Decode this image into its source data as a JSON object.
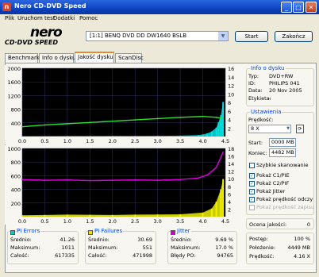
{
  "window": {
    "title": "Nero CD-DVD Speed"
  },
  "menu": [
    "Plik",
    "Uruchom test",
    "Dodatki",
    "Pomoc"
  ],
  "logo": {
    "nero": "nero",
    "sub": "CD·DVD SPEED"
  },
  "drive": {
    "selected": "[1:1]  BENQ DVD DD DW1640 BSLB"
  },
  "buttons": {
    "start": "Start",
    "close": "Zakończ"
  },
  "tabs": [
    "Benchmark",
    "Info o dysku",
    "Jakość dysku",
    "ScanDisc"
  ],
  "disc_info": {
    "title": "Info o dysku",
    "rows": [
      {
        "label": "Typ:",
        "value": "DVD+RW"
      },
      {
        "label": "ID:",
        "value": "PHILIPS 041"
      },
      {
        "label": "Data:",
        "value": "20 Nov 2005"
      },
      {
        "label": "Etykieta:",
        "value": "-"
      }
    ]
  },
  "settings": {
    "title": "Ustawienia",
    "speed_label": "Prędkość:",
    "speed_value": "8 X",
    "start_label": "Start:",
    "start_value": "0000 MB",
    "end_label": "Koniec:",
    "end_value": "4482 MB",
    "checkboxes": [
      {
        "label": "Szybkie skanowanie",
        "checked": false
      },
      {
        "label": "Pokaż C1/PIE",
        "checked": true
      },
      {
        "label": "Pokaż C2/PIF",
        "checked": true
      },
      {
        "label": "Pokaż Jitter",
        "checked": true
      },
      {
        "label": "Pokaż prędkość odczy",
        "checked": true
      },
      {
        "label": "Pokaż prędkość zapisu",
        "checked": false
      }
    ]
  },
  "quality": {
    "label": "Ocena jakości:",
    "value": "0"
  },
  "progress": [
    {
      "label": "Postęp:",
      "value": "100 %"
    },
    {
      "label": "Położenie:",
      "value": "4449 MB"
    },
    {
      "label": "Prędkość:",
      "value": "4.16 X"
    }
  ],
  "stats": {
    "pie": {
      "title": "PI Errors",
      "color": "#00C8C8",
      "rows": [
        {
          "label": "Średnio:",
          "value": "41.26"
        },
        {
          "label": "Maksimum:",
          "value": "1011"
        },
        {
          "label": "Całość:",
          "value": "617335"
        }
      ]
    },
    "pif": {
      "title": "PI Failures",
      "color": "#F0E000",
      "rows": [
        {
          "label": "Średnio:",
          "value": "30.69"
        },
        {
          "label": "Maksimum:",
          "value": "551"
        },
        {
          "label": "Całość:",
          "value": "471998"
        }
      ]
    },
    "jitter": {
      "title": "Jitter",
      "color": "#D000D0",
      "rows": [
        {
          "label": "Średnio:",
          "value": "9.69 %"
        },
        {
          "label": "Maksimum:",
          "value": "17.0 %"
        },
        {
          "label": "Błędy PO:",
          "value": "94765"
        }
      ]
    }
  },
  "chart_data": [
    {
      "type": "area",
      "name": "PI Errors",
      "xlim": [
        0,
        4.5
      ],
      "ylim": [
        0,
        2000
      ],
      "y2lim": [
        0,
        16
      ],
      "x_ticks": [
        "0.0",
        "0.5",
        "1.0",
        "1.5",
        "2.0",
        "2.5",
        "3.0",
        "3.5",
        "4.0",
        "4.5"
      ],
      "y_ticks": [
        "2000",
        "1600",
        "1200",
        "800",
        "400"
      ],
      "y2_ticks": [
        "16",
        "14",
        "12",
        "10",
        "8",
        "6",
        "4",
        "2"
      ],
      "series": [
        {
          "color": "#00E0E0",
          "x": [
            0,
            0.5,
            1.0,
            1.5,
            2.0,
            2.5,
            3.0,
            3.5,
            3.9,
            4.0,
            4.1,
            4.2,
            4.3,
            4.35,
            4.4,
            4.45
          ],
          "values": [
            10,
            12,
            15,
            14,
            16,
            18,
            20,
            25,
            40,
            60,
            90,
            150,
            260,
            420,
            620,
            1011
          ]
        },
        {
          "color": "#30E030",
          "x": [
            0,
            0.5,
            1.0,
            1.5,
            2.0,
            2.5,
            3.0,
            3.5,
            4.0,
            4.3,
            4.45
          ],
          "values": [
            2.3,
            2.7,
            3.0,
            3.3,
            3.6,
            3.9,
            4.2,
            4.5,
            4.7,
            4.5,
            4.2
          ]
        }
      ]
    },
    {
      "type": "area",
      "name": "PI Failures / Jitter",
      "xlim": [
        0,
        4.5
      ],
      "ylim": [
        0,
        1000
      ],
      "y2lim": [
        0,
        18
      ],
      "x_ticks": [
        "0.0",
        "0.5",
        "1.0",
        "1.5",
        "2.0",
        "2.5",
        "3.0",
        "3.5",
        "4.0",
        "4.5"
      ],
      "y_ticks": [
        "1000",
        "800",
        "600",
        "400",
        "200"
      ],
      "y2_ticks": [
        "18",
        "16",
        "14",
        "12",
        "10",
        "8",
        "6",
        "4",
        "2"
      ],
      "series": [
        {
          "color": "#F0F000",
          "x": [
            0,
            0.5,
            1.0,
            1.5,
            2.0,
            2.5,
            3.0,
            3.5,
            4.0,
            4.2,
            4.3,
            4.4,
            4.45
          ],
          "values": [
            20,
            25,
            30,
            28,
            25,
            30,
            32,
            35,
            60,
            120,
            220,
            400,
            551
          ]
        },
        {
          "color": "#E000E0",
          "x": [
            0,
            0.5,
            1.0,
            1.5,
            2.0,
            2.5,
            3.0,
            3.5,
            3.9,
            4.1,
            4.3,
            4.45
          ],
          "values": [
            9.8,
            9.6,
            9.7,
            9.5,
            9.6,
            9.7,
            9.6,
            9.8,
            10.2,
            11.0,
            13.0,
            17.0
          ]
        }
      ]
    }
  ]
}
